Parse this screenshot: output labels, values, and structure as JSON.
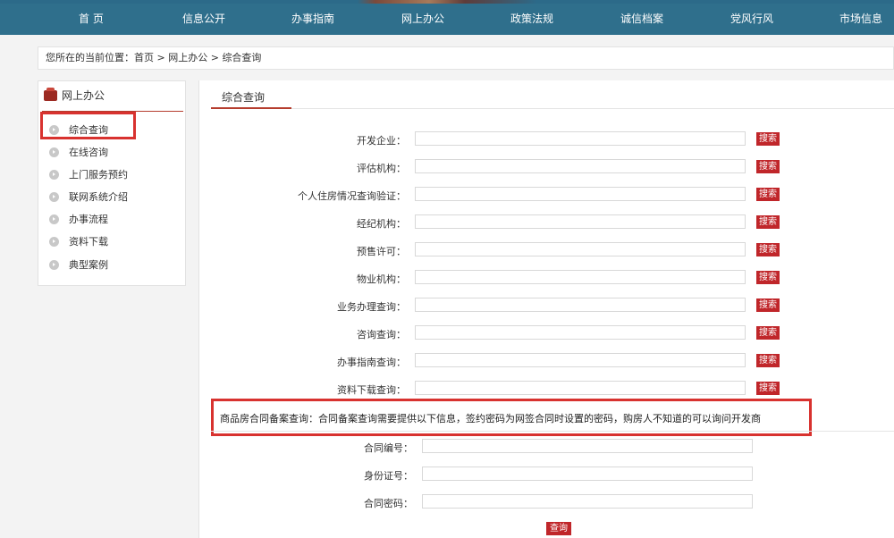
{
  "nav": {
    "items": [
      "首 页",
      "信息公开",
      "办事指南",
      "网上办公",
      "政策法规",
      "诚信档案",
      "党风行风",
      "市场信息"
    ]
  },
  "breadcrumb": {
    "prefix": "您所在的当前位置：",
    "home": "首页",
    "sep1": " > ",
    "section": "网上办公",
    "sep2": " > ",
    "current": "综合查询"
  },
  "sidebar": {
    "title": "网上办公",
    "items": [
      {
        "label": "综合查询"
      },
      {
        "label": "在线咨询"
      },
      {
        "label": "上门服务预约"
      },
      {
        "label": "联网系统介绍"
      },
      {
        "label": "办事流程"
      },
      {
        "label": "资料下载"
      },
      {
        "label": "典型案例"
      }
    ]
  },
  "main": {
    "tab": "综合查询",
    "search_rows": [
      {
        "label": "开发企业：",
        "value": "",
        "button": "搜索"
      },
      {
        "label": "评估机构：",
        "value": "",
        "button": "搜索"
      },
      {
        "label": "个人住房情况查询验证：",
        "value": "",
        "button": "搜索"
      },
      {
        "label": "经纪机构：",
        "value": "",
        "button": "搜索"
      },
      {
        "label": "预售许可：",
        "value": "",
        "button": "搜索"
      },
      {
        "label": "物业机构：",
        "value": "",
        "button": "搜索"
      },
      {
        "label": "业务办理查询：",
        "value": "",
        "button": "搜索"
      },
      {
        "label": "咨询查询：",
        "value": "",
        "button": "搜索"
      },
      {
        "label": "办事指南查询：",
        "value": "",
        "button": "搜索"
      },
      {
        "label": "资料下载查询：",
        "value": "",
        "button": "搜索"
      }
    ],
    "contract": {
      "note_title": "商品房合同备案查询：",
      "note_body": "合同备案查询需要提供以下信息，签约密码为网签合同时设置的密码，购房人不知道的可以询问开发商",
      "fields": [
        {
          "label": "合同编号：",
          "value": ""
        },
        {
          "label": "身份证号：",
          "value": ""
        },
        {
          "label": "合同密码：",
          "value": ""
        }
      ],
      "submit": "查询"
    }
  },
  "colors": {
    "nav_bg": "#2f6f8c",
    "button_red": "#c0262a",
    "highlight_box": "#d8322f"
  }
}
